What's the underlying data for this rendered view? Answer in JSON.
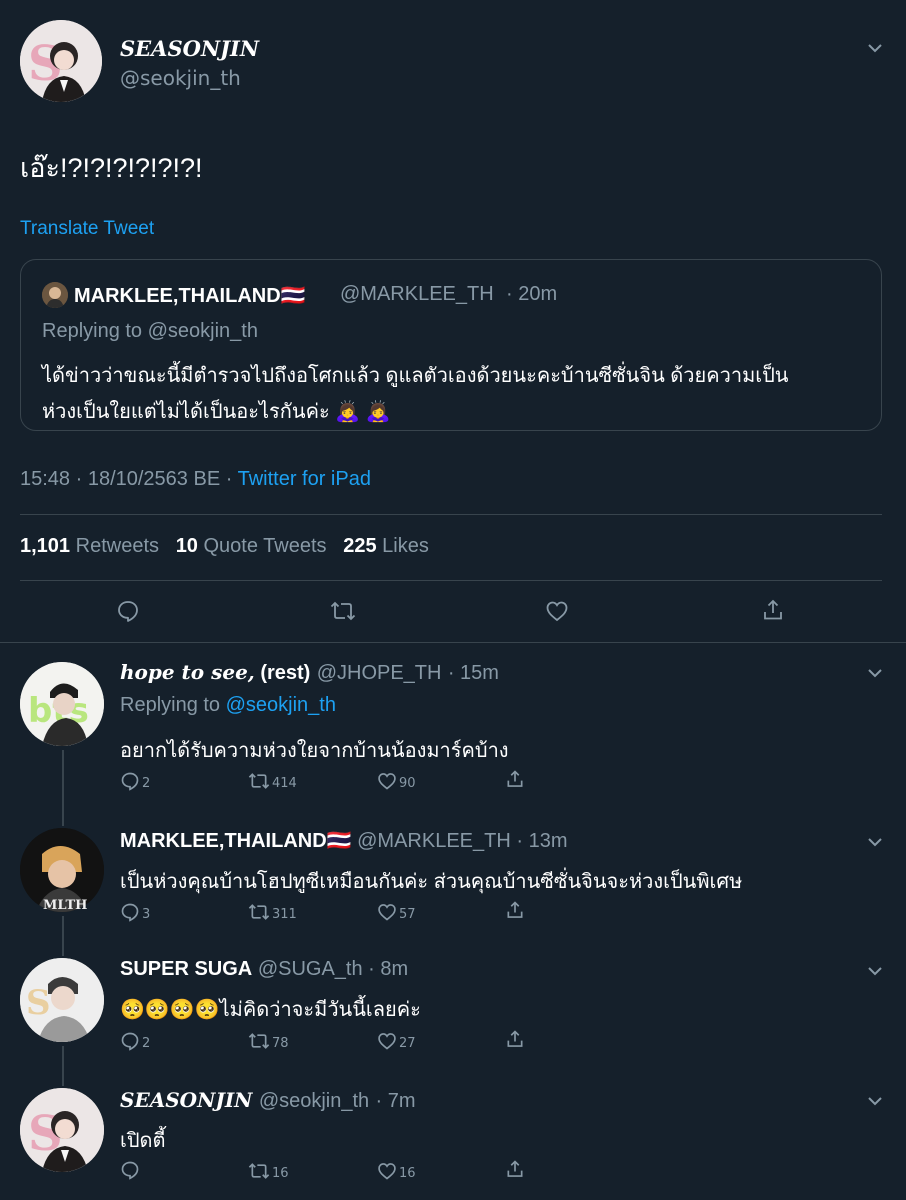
{
  "main_tweet": {
    "display_name": "SEASONJIN",
    "handle": "@seokjin_th",
    "text": "เอ๊ะ!?!?!?!?!?!?!",
    "translate_label": "Translate Tweet",
    "quoted": {
      "display_name": "MARKLEE,THAILAND🇹🇭",
      "handle": "@MARKLEE_TH",
      "time": "· 20m",
      "replying_label": "Replying to @seokjin_th",
      "text_line1": "ได้ข่าวว่าขณะนี้มีตำรวจไปถึงอโศกแล้ว ดูแลตัวเองด้วยนะคะบ้านซีซั่นจิน ด้วยความเป็น",
      "text_line2": "ห่วงเป็นใยแต่ไม่ได้เป็นอะไรกันค่ะ 🙇‍♀️ 🙇‍♀️"
    },
    "timestamp": "15:48 · 18/10/2563 BE ·",
    "source": "Twitter for iPad",
    "stats": {
      "retweets_count": "1,101",
      "retweets_label": "Retweets",
      "quotes_count": "10",
      "quotes_label": "Quote Tweets",
      "likes_count": "225",
      "likes_label": "Likes"
    }
  },
  "replies": [
    {
      "display_name": "hope to see,",
      "display_name_suffix": " (rest)",
      "handle": "@JHOPE_TH",
      "time": "· 15m",
      "replying_prefix": "Replying to",
      "replying_handle": "@seokjin_th",
      "text": "อยากได้รับความห่วงใยจากบ้านน้องมาร์คบ้าง",
      "counts": {
        "reply": "2",
        "retweet": "414",
        "like": "90"
      }
    },
    {
      "display_name": "MARKLEE,THAILAND🇹🇭",
      "handle": "@MARKLEE_TH",
      "time": "· 13m",
      "text": "เป็นห่วงคุณบ้านโฮปทูซีเหมือนกันค่ะ ส่วนคุณบ้านซีซั่นจินจะห่วงเป็นพิเศษ",
      "avatar_label": "MLTH",
      "counts": {
        "reply": "3",
        "retweet": "311",
        "like": "57"
      }
    },
    {
      "display_name": "SUPER SUGA",
      "handle": "@SUGA_th",
      "time": "· 8m",
      "text": "🥺🥺🥺🥺ไม่คิดว่าจะมีวันนี้เลยค่ะ",
      "counts": {
        "reply": "2",
        "retweet": "78",
        "like": "27"
      }
    },
    {
      "display_name": "SEASONJIN",
      "handle": "@seokjin_th",
      "time": "· 7m",
      "text": "เปิดตี้",
      "counts": {
        "reply": "",
        "retweet": "16",
        "like": "16"
      }
    }
  ],
  "colors": {
    "background": "#15202b",
    "accent": "#1da1f2",
    "muted": "#8899a6",
    "border": "#38444d"
  }
}
